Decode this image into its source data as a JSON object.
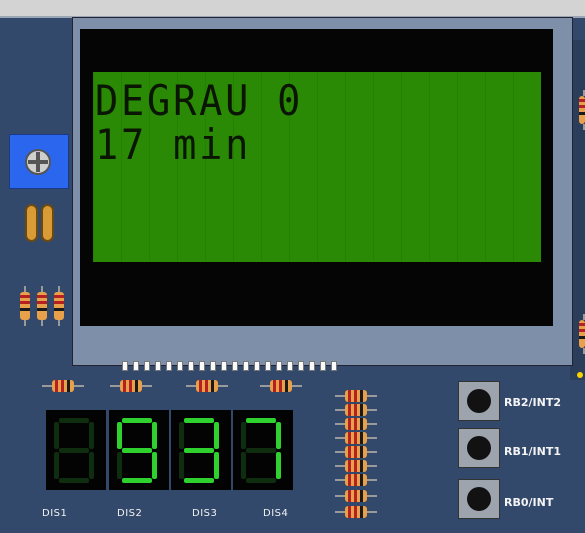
{
  "lcd": {
    "line1": "DEGRAU 0",
    "line2": "17 min",
    "background_color": "#2a8a05",
    "text_color": "#0a1602"
  },
  "displays": [
    {
      "label": "DIS1",
      "digit": "8",
      "lit": false
    },
    {
      "label": "DIS2",
      "digit": "9",
      "lit": true
    },
    {
      "label": "DIS3",
      "digit": "3",
      "lit": true
    },
    {
      "label": "DIS4",
      "digit": "7",
      "lit": true
    }
  ],
  "buttons": [
    {
      "label": "RB2/INT2"
    },
    {
      "label": "RB1/INT1"
    },
    {
      "label": "RB0/INT"
    }
  ],
  "icons": {
    "potentiometer": "potentiometer-icon",
    "capacitor": "capacitor-icon",
    "resistor": "resistor-icon"
  },
  "colors": {
    "board": "#33496b",
    "segment_on": "#2ed12e",
    "segment_off": "#0f2e0f",
    "potentiometer": "#2a66ee"
  }
}
